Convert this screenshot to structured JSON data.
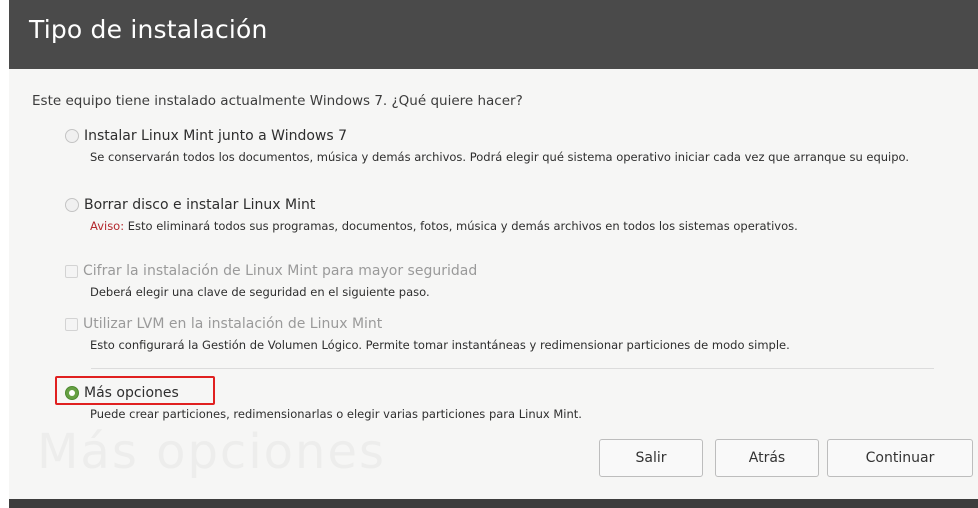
{
  "window": {
    "title": "Tipo de instalación"
  },
  "question": "Este equipo tiene instalado actualmente Windows 7. ¿Qué quiere hacer?",
  "options": [
    {
      "label": "Instalar Linux Mint junto a Windows 7",
      "description": "Se conservarán todos los documentos, música y demás archivos. Podrá elegir qué sistema operativo iniciar cada vez que arranque su equipo.",
      "type": "radio",
      "selected": false
    },
    {
      "label": "Borrar disco e instalar Linux Mint",
      "warning_prefix": "Aviso:",
      "description": " Esto eliminará todos sus programas, documentos, fotos, música y demás archivos en todos los sistemas operativos.",
      "type": "radio",
      "selected": false
    },
    {
      "label": "Cifrar la instalación de Linux Mint para mayor seguridad",
      "description": "Deberá elegir una clave de seguridad en el siguiente paso.",
      "type": "checkbox",
      "checked": false,
      "enabled": false
    },
    {
      "label": "Utilizar LVM en la instalación de Linux Mint",
      "description": "Esto configurará la Gestión de Volumen Lógico. Permite tomar instantáneas y redimensionar particiones de modo simple.",
      "type": "checkbox",
      "checked": false,
      "enabled": false
    },
    {
      "label": "Más opciones",
      "description": "Puede crear particiones, redimensionarlas o elegir varias particiones para Linux Mint.",
      "type": "radio",
      "selected": true
    }
  ],
  "watermark": "Más opciones",
  "buttons": {
    "quit": "Salir",
    "back": "Atrás",
    "continue": "Continuar"
  },
  "colors": {
    "titlebar": "#4a4a4a",
    "accent": "#66a043",
    "warning": "#b3282d",
    "highlight": "#e02020"
  }
}
